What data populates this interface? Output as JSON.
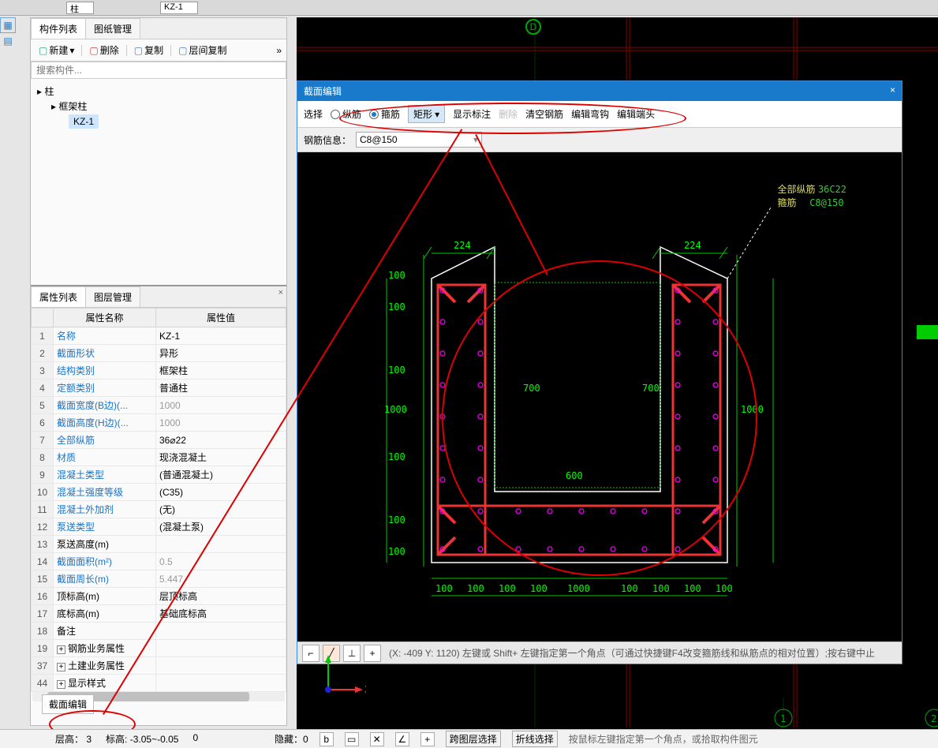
{
  "top": {
    "sel1": "柱",
    "sel2": "KZ-1"
  },
  "tabs": {
    "component_list": "构件列表",
    "drawing_mgmt": "图纸管理"
  },
  "toolbar": {
    "new": "新建",
    "delete": "删除",
    "copy": "复制",
    "layer_copy": "层间复制"
  },
  "search_placeholder": "搜索构件...",
  "tree": {
    "root": "柱",
    "child": "框架柱",
    "leaf": "KZ-1"
  },
  "prop_tabs": {
    "props": "属性列表",
    "layer_mgmt": "图层管理"
  },
  "prop_headers": {
    "name": "属性名称",
    "value": "属性值"
  },
  "props": [
    {
      "n": "1",
      "name": "名称",
      "val": "KZ-1",
      "link": true
    },
    {
      "n": "2",
      "name": "截面形状",
      "val": "异形",
      "link": true
    },
    {
      "n": "3",
      "name": "结构类别",
      "val": "框架柱",
      "link": true
    },
    {
      "n": "4",
      "name": "定额类别",
      "val": "普通柱",
      "link": true
    },
    {
      "n": "5",
      "name": "截面宽度(B边)(...",
      "val": "1000",
      "link": true,
      "gray": true
    },
    {
      "n": "6",
      "name": "截面高度(H边)(...",
      "val": "1000",
      "link": true,
      "gray": true
    },
    {
      "n": "7",
      "name": "全部纵筋",
      "val": "36⌀22",
      "link": true
    },
    {
      "n": "8",
      "name": "材质",
      "val": "现浇混凝土",
      "link": true
    },
    {
      "n": "9",
      "name": "混凝土类型",
      "val": "(普通混凝土)",
      "link": true
    },
    {
      "n": "10",
      "name": "混凝土强度等级",
      "val": "(C35)",
      "link": true
    },
    {
      "n": "11",
      "name": "混凝土外加剂",
      "val": "(无)",
      "link": true
    },
    {
      "n": "12",
      "name": "泵送类型",
      "val": "(混凝土泵)",
      "link": true
    },
    {
      "n": "13",
      "name": "泵送高度(m)",
      "val": ""
    },
    {
      "n": "14",
      "name": "截面面积(m²)",
      "val": "0.5",
      "link": true,
      "gray": true
    },
    {
      "n": "15",
      "name": "截面周长(m)",
      "val": "5.447",
      "link": true,
      "gray": true
    },
    {
      "n": "16",
      "name": "顶标高(m)",
      "val": "层顶标高"
    },
    {
      "n": "17",
      "name": "底标高(m)",
      "val": "基础底标高"
    },
    {
      "n": "18",
      "name": "备注",
      "val": ""
    },
    {
      "n": "19",
      "name": "钢筋业务属性",
      "val": "",
      "exp": true
    },
    {
      "n": "37",
      "name": "土建业务属性",
      "val": "",
      "exp": true
    },
    {
      "n": "44",
      "name": "显示样式",
      "val": "",
      "exp": true
    }
  ],
  "section_edit_btn": "截面编辑",
  "editor": {
    "title": "截面编辑",
    "tb": {
      "select": "选择",
      "zongjin": "纵筋",
      "gujin": "箍筋",
      "rect": "矩形",
      "show_dim": "显示标注",
      "delete": "删除",
      "clear": "清空钢筋",
      "edit_hook": "编辑弯钩",
      "edit_end": "编辑端头"
    },
    "info_label": "钢筋信息：",
    "info_val": "C8@150",
    "legend": {
      "all": "全部纵筋",
      "all_v": "36C22",
      "gu": "箍筋",
      "gu_v": "C8@150"
    },
    "btm_hint": "(X: -409 Y: 1120)  左键或 Shift+ 左键指定第一个角点（可通过快捷键F4改变箍筋线和纵筋点的相对位置）;按右键中止"
  },
  "status": {
    "floor_h": "层高：",
    "floor_h_v": "3",
    "elev": "标高:",
    "elev_v": "-3.05~-0.05",
    "zero": "0",
    "hidden": "隐藏：",
    "hidden_v": "0",
    "cross": "跨图层选择",
    "fold": "折线选择",
    "hint": "按鼠标左键指定第一个角点，或拾取构件图元"
  },
  "axis": {
    "x": "X"
  },
  "grid_labels": {
    "d": "D",
    "one": "1",
    "two": "2"
  }
}
